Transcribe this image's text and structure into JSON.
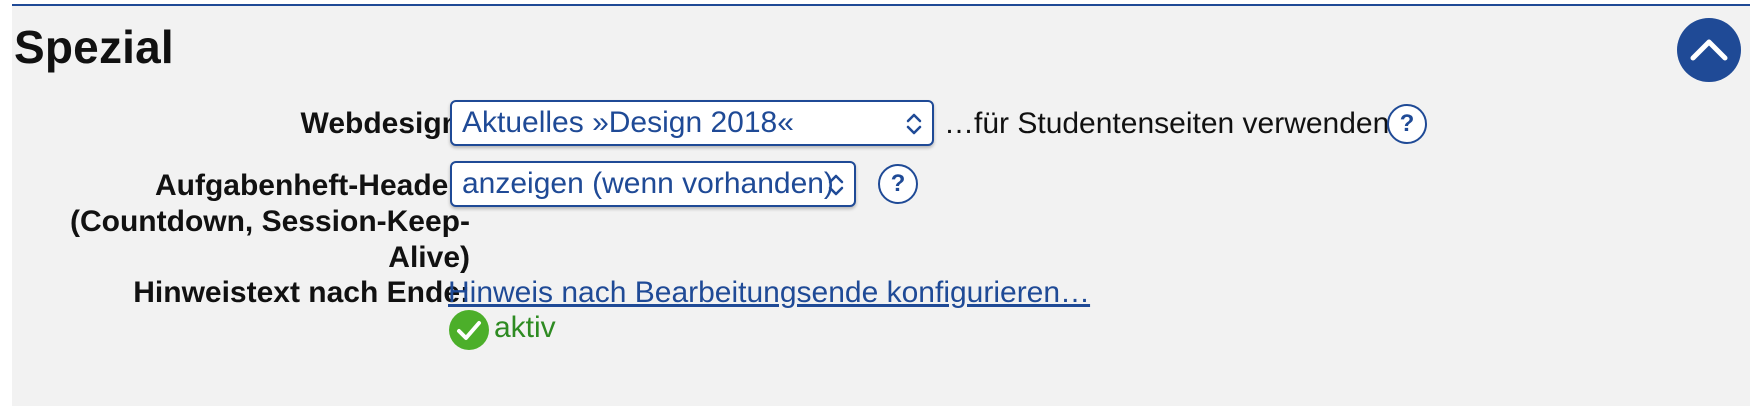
{
  "section": {
    "title": "Spezial",
    "collapse_icon": "chevron-up-icon"
  },
  "webdesign": {
    "label": "Webdesign:",
    "selected": "Aktuelles »Design 2018«",
    "suffix": "…für Studentenseiten verwenden",
    "help": "?"
  },
  "header": {
    "label_line1": "Aufgabenheft-Header:",
    "label_line2": "(Countdown, Session-Keep-",
    "label_line3": "Alive)",
    "selected": "anzeigen (wenn vorhanden)",
    "help": "?"
  },
  "hint": {
    "label": "Hinweistext nach Ende:",
    "link": "Hinweis nach Bearbeitungsende konfigurieren…",
    "status": "aktiv",
    "status_icon": "checkmark-icon"
  },
  "colors": {
    "accent": "#1f4a96",
    "panel_bg": "#f2f2f2",
    "success": "#4caf2a",
    "success_text": "#2e8b22"
  }
}
